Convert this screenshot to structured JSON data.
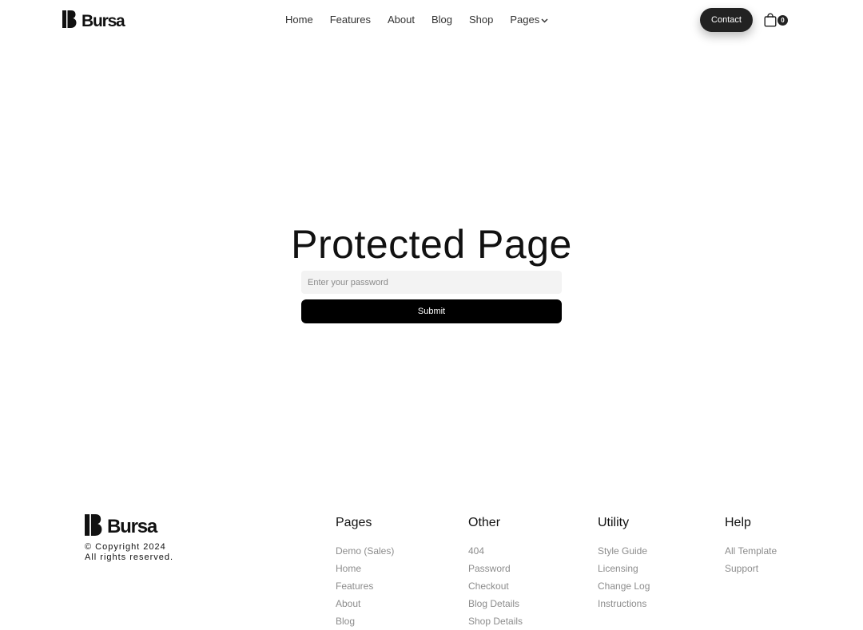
{
  "brand": {
    "name": "Bursa"
  },
  "nav": {
    "items": [
      "Home",
      "Features",
      "About",
      "Blog",
      "Shop"
    ],
    "pages_label": "Pages",
    "contact_label": "Contact",
    "cart_count": "0"
  },
  "main": {
    "title": "Protected Page",
    "password_placeholder": "Enter your password",
    "submit_label": "Submit"
  },
  "footer": {
    "copyright_line1": "© Copyright 2024",
    "copyright_line2": "All rights reserved.",
    "columns": [
      {
        "title": "Pages",
        "links": [
          "Demo (Sales)",
          "Home",
          "Features",
          "About",
          "Blog"
        ]
      },
      {
        "title": "Other",
        "links": [
          "404",
          "Password",
          "Checkout",
          "Blog Details",
          "Shop Details"
        ]
      },
      {
        "title": "Utility",
        "links": [
          "Style Guide",
          "Licensing",
          "Change Log",
          "Instructions"
        ]
      },
      {
        "title": "Help",
        "links": [
          "All Template",
          "Support"
        ]
      }
    ]
  },
  "colors": {
    "text": "#111111",
    "muted_link": "#8c8c8c",
    "button_dark": "#000000",
    "contact_button": "#222222",
    "input_bg": "#f3f3f3"
  },
  "icons": [
    "logo-mark-icon",
    "chevron-down-icon",
    "shopping-bag-icon"
  ]
}
